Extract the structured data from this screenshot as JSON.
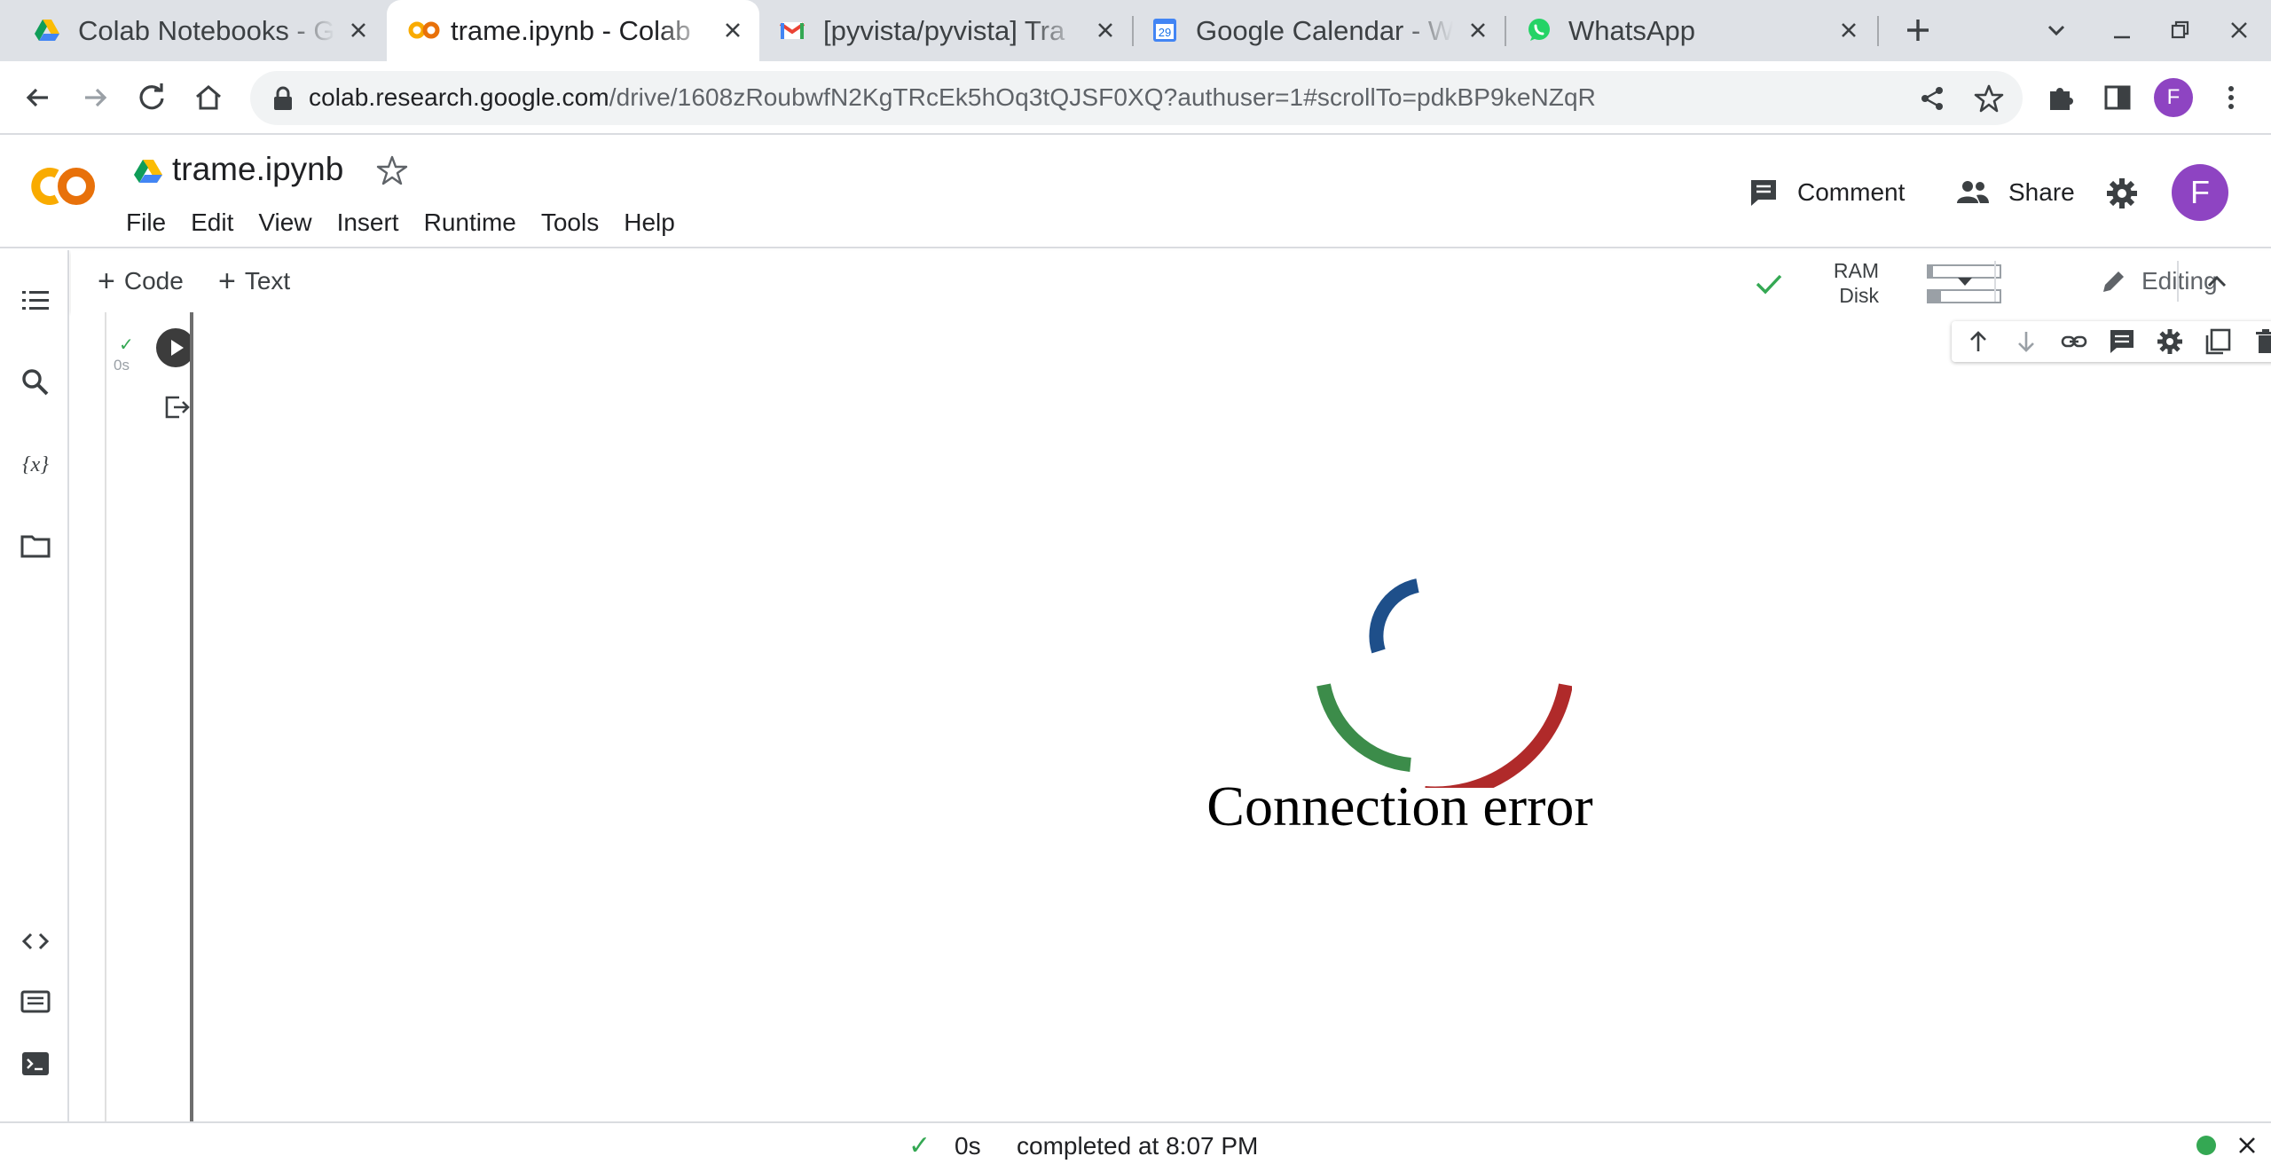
{
  "browser": {
    "tabs": [
      {
        "title": "Colab Notebooks - G",
        "icon": "google-drive-icon",
        "active": false
      },
      {
        "title": "trame.ipynb - Colab",
        "icon": "colab-icon",
        "active": true
      },
      {
        "title": "[pyvista/pyvista] Tra",
        "icon": "gmail-icon",
        "active": false
      },
      {
        "title": "Google Calendar - W",
        "icon": "google-calendar-icon",
        "active": false
      },
      {
        "title": "WhatsApp",
        "icon": "whatsapp-icon",
        "active": false
      }
    ],
    "calendar_day": "29",
    "address": {
      "host": "colab.research.google.com",
      "path": "/drive/1608zRoubwfN2KgTRcEk5hOq3tQJSF0XQ?authuser=1#scrollTo=pdkBP9keNZqR"
    },
    "profile_initial": "F"
  },
  "colab": {
    "logo": "CO",
    "notebook_title": "trame.ipynb",
    "menu": [
      "File",
      "Edit",
      "View",
      "Insert",
      "Runtime",
      "Tools",
      "Help"
    ],
    "comment_label": "Comment",
    "share_label": "Share",
    "profile_initial": "F"
  },
  "cell_toolbar": {
    "add_code_label": "Code",
    "add_text_label": "Text",
    "ram_label": "RAM",
    "disk_label": "Disk",
    "ram_usage": 0.06,
    "disk_usage": 0.18,
    "editing_label": "Editing"
  },
  "cell": {
    "exec_time": "0s",
    "output_message": "Connection error"
  },
  "status": {
    "time": "0s",
    "message": "completed at 8:07 PM",
    "colors": {
      "ok": "#34a853"
    }
  },
  "colors": {
    "spinner_blue": "#1e4f8a",
    "spinner_green": "#3c8c4a",
    "spinner_red": "#b02a2a",
    "colab_orange": "#f9ab00",
    "colab_dark_orange": "#e8710a"
  }
}
